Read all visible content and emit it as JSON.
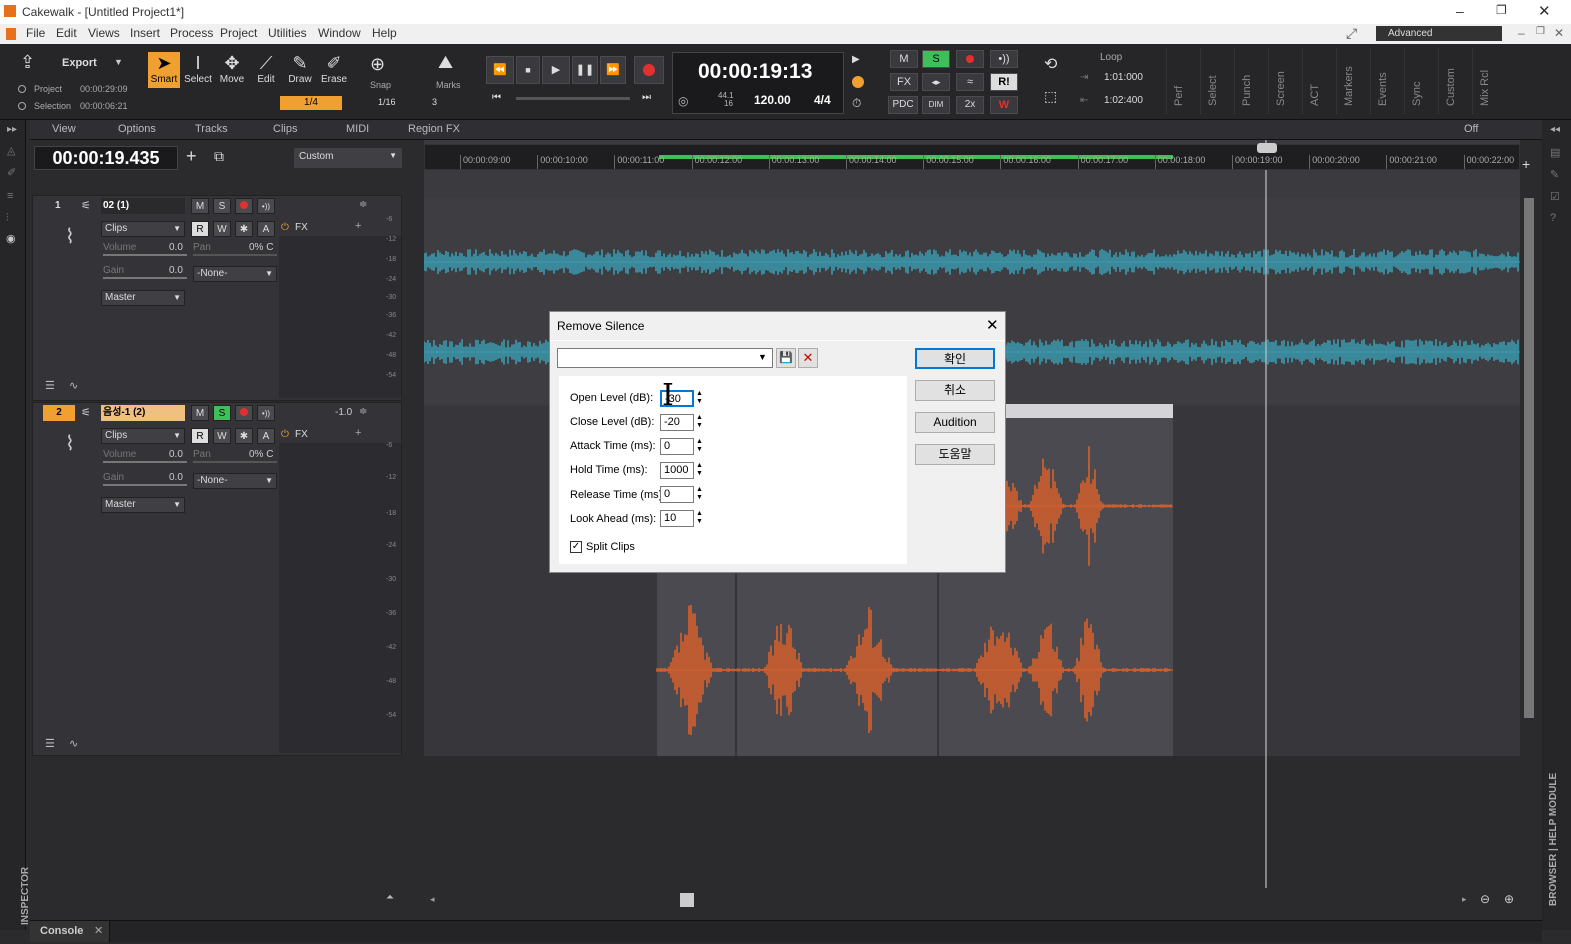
{
  "window": {
    "title": "Cakewalk - [Untitled Project1*]"
  },
  "menu": [
    "File",
    "Edit",
    "Views",
    "Insert",
    "Process",
    "Project",
    "Utilities",
    "Window",
    "Help"
  ],
  "toolbar": {
    "export_label": "Export",
    "project_label": "Project",
    "project_time": "00:00:29:09",
    "selection_label": "Selection",
    "selection_time": "00:00:06:21",
    "tools": [
      "Smart",
      "Select",
      "Move",
      "Edit",
      "Draw",
      "Erase"
    ],
    "snap_label": "Snap",
    "snap_value": "1/16",
    "snap_num": "3",
    "marks_label": "Marks",
    "snap_sub": "1/4",
    "time_display": "00:00:19:13",
    "sample_rate": "44.1",
    "bit_depth": "16",
    "tempo": "120.00",
    "meter": "4/4",
    "mix_buttons": [
      "M",
      "S",
      "FX",
      "PDC",
      "DIM",
      "2x"
    ],
    "loop_label": "Loop",
    "loop_start": "1:01:000",
    "loop_end": "1:02:400",
    "module_tabs": [
      "Perf",
      "Select",
      "Punch",
      "Screen",
      "ACT",
      "Markers",
      "Events",
      "Sync",
      "Custom",
      "Mix Rcl"
    ],
    "workspace": "Advanced"
  },
  "viewbar": {
    "items": [
      "View",
      "Options",
      "Tracks",
      "Clips",
      "MIDI",
      "Region FX"
    ],
    "off_label": "Off"
  },
  "now_time": "00:00:19.435",
  "track_filter": "Custom",
  "timeline": {
    "ticks": [
      "00:00:09:00",
      "00:00:10:00",
      "00:00:11:00",
      "00:00:12:00",
      "00:00:13:00",
      "00:00:14:00",
      "00:00:15:00",
      "00:00:16:00",
      "00:00:17:00",
      "00:00:18:00",
      "00:00:19:00",
      "00:00:20:00",
      "00:00:21:00",
      "00:00:22:00"
    ]
  },
  "tracks": [
    {
      "num": "1",
      "name": "02 (1)",
      "clips": "Clips",
      "volume_label": "Volume",
      "volume": "0.0",
      "pan_label": "Pan",
      "pan": "0% C",
      "gain_label": "Gain",
      "gain": "0.0",
      "input": "-None-",
      "output": "Master",
      "fx": "FX",
      "trim": ""
    },
    {
      "num": "2",
      "name": "음성-1 (2)",
      "clips": "Clips",
      "volume_label": "Volume",
      "volume": "0.0",
      "pan_label": "Pan",
      "pan": "0% C",
      "gain_label": "Gain",
      "gain": "0.0",
      "input": "-None-",
      "output": "Master",
      "fx": "FX",
      "trim": "-1.0"
    }
  ],
  "track_buttons": {
    "m": "M",
    "s": "S",
    "r": "R",
    "w": "W",
    "a": "A"
  },
  "meter_scale": [
    "-6",
    "-12",
    "-18",
    "-24",
    "-30",
    "-36",
    "-42",
    "-48",
    "-54"
  ],
  "dialog": {
    "title": "Remove Silence",
    "ok": "확인",
    "cancel": "취소",
    "audition": "Audition",
    "help": "도움말",
    "fields": [
      {
        "label": "Open Level (dB):",
        "value": "-30"
      },
      {
        "label": "Close Level (dB):",
        "value": "-20"
      },
      {
        "label": "Attack Time (ms):",
        "value": "0"
      },
      {
        "label": "Hold Time (ms):",
        "value": "1000"
      },
      {
        "label": "Release Time (ms):",
        "value": "0"
      },
      {
        "label": "Look Ahead (ms):",
        "value": "10"
      }
    ],
    "split_clips": "Split Clips"
  },
  "status": {
    "console": "Console",
    "inspector": "INSPECTOR",
    "browser": "BROWSER | HELP MODULE"
  },
  "colors": {
    "audio1": "#3a9bb0",
    "audio2": "#d9602a",
    "solo": "#3fbf5a",
    "record": "#e23030",
    "accent": "#f0a030"
  }
}
